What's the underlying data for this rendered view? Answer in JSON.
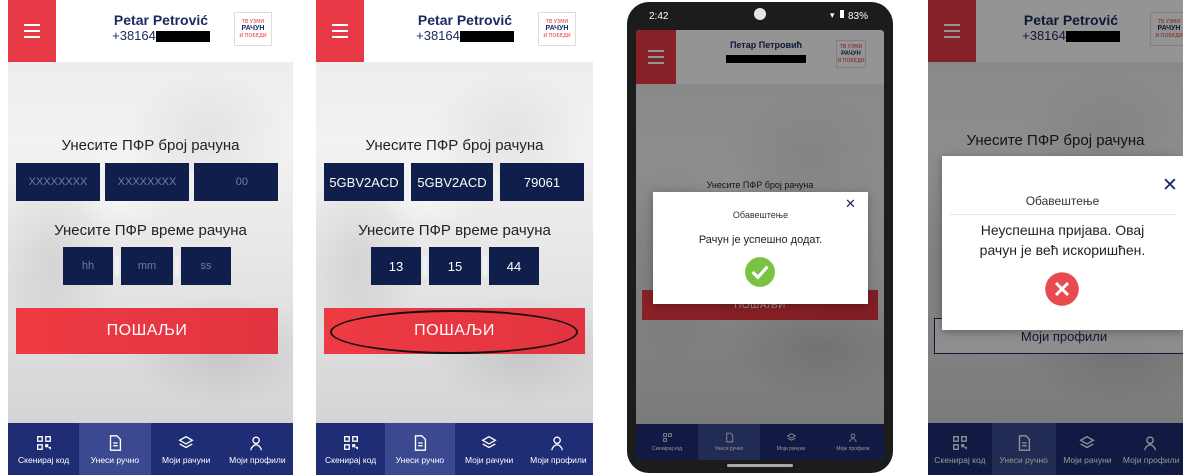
{
  "user": {
    "name": "Petar Petrović",
    "phone": "+38164",
    "name_cyrillic": "Петар Петровић"
  },
  "logo": {
    "line1": "ТВ УЗМИ",
    "line2": "РАЧУН",
    "line3": "И ПОБЕДИ"
  },
  "form": {
    "pfr_number_label": "Унесите ПФР број рачуна",
    "pfr_time_label": "Унесите ПФР време рачуна",
    "send_button": "ПОШАЉИ",
    "placeholders": {
      "part1": "XXXXXXXX",
      "part2": "XXXXXXXX",
      "part3": "00",
      "hh": "hh",
      "mm": "mm",
      "ss": "ss"
    },
    "filled": {
      "part1": "5GBV2ACD",
      "part2": "5GBV2ACD",
      "part3": "79061",
      "hh": "13",
      "mm": "15",
      "ss": "44"
    }
  },
  "nav": [
    {
      "label": "Скенирај код",
      "icon": "qr-scan-icon"
    },
    {
      "label": "Унеси ручно",
      "icon": "document-icon"
    },
    {
      "label": "Моји рачуни",
      "icon": "layers-icon"
    },
    {
      "label": "Моји профили",
      "icon": "user-icon"
    }
  ],
  "status_bar": {
    "time": "2:42",
    "battery": "83%"
  },
  "notice_success": {
    "title": "Обавештење",
    "message": "Рачун је успешно додат."
  },
  "notice_error": {
    "title": "Обавештење",
    "message_line1": "Неуспешна пријава. Овај",
    "message_line2": "рачун је већ искоришћен."
  },
  "profiles_button": "Моји профили",
  "colors": {
    "accent_red": "#e73a46",
    "navy": "#1d2a63",
    "nav_bg": "#1f2d74",
    "success": "#7cc242",
    "error": "#e84a4f"
  }
}
